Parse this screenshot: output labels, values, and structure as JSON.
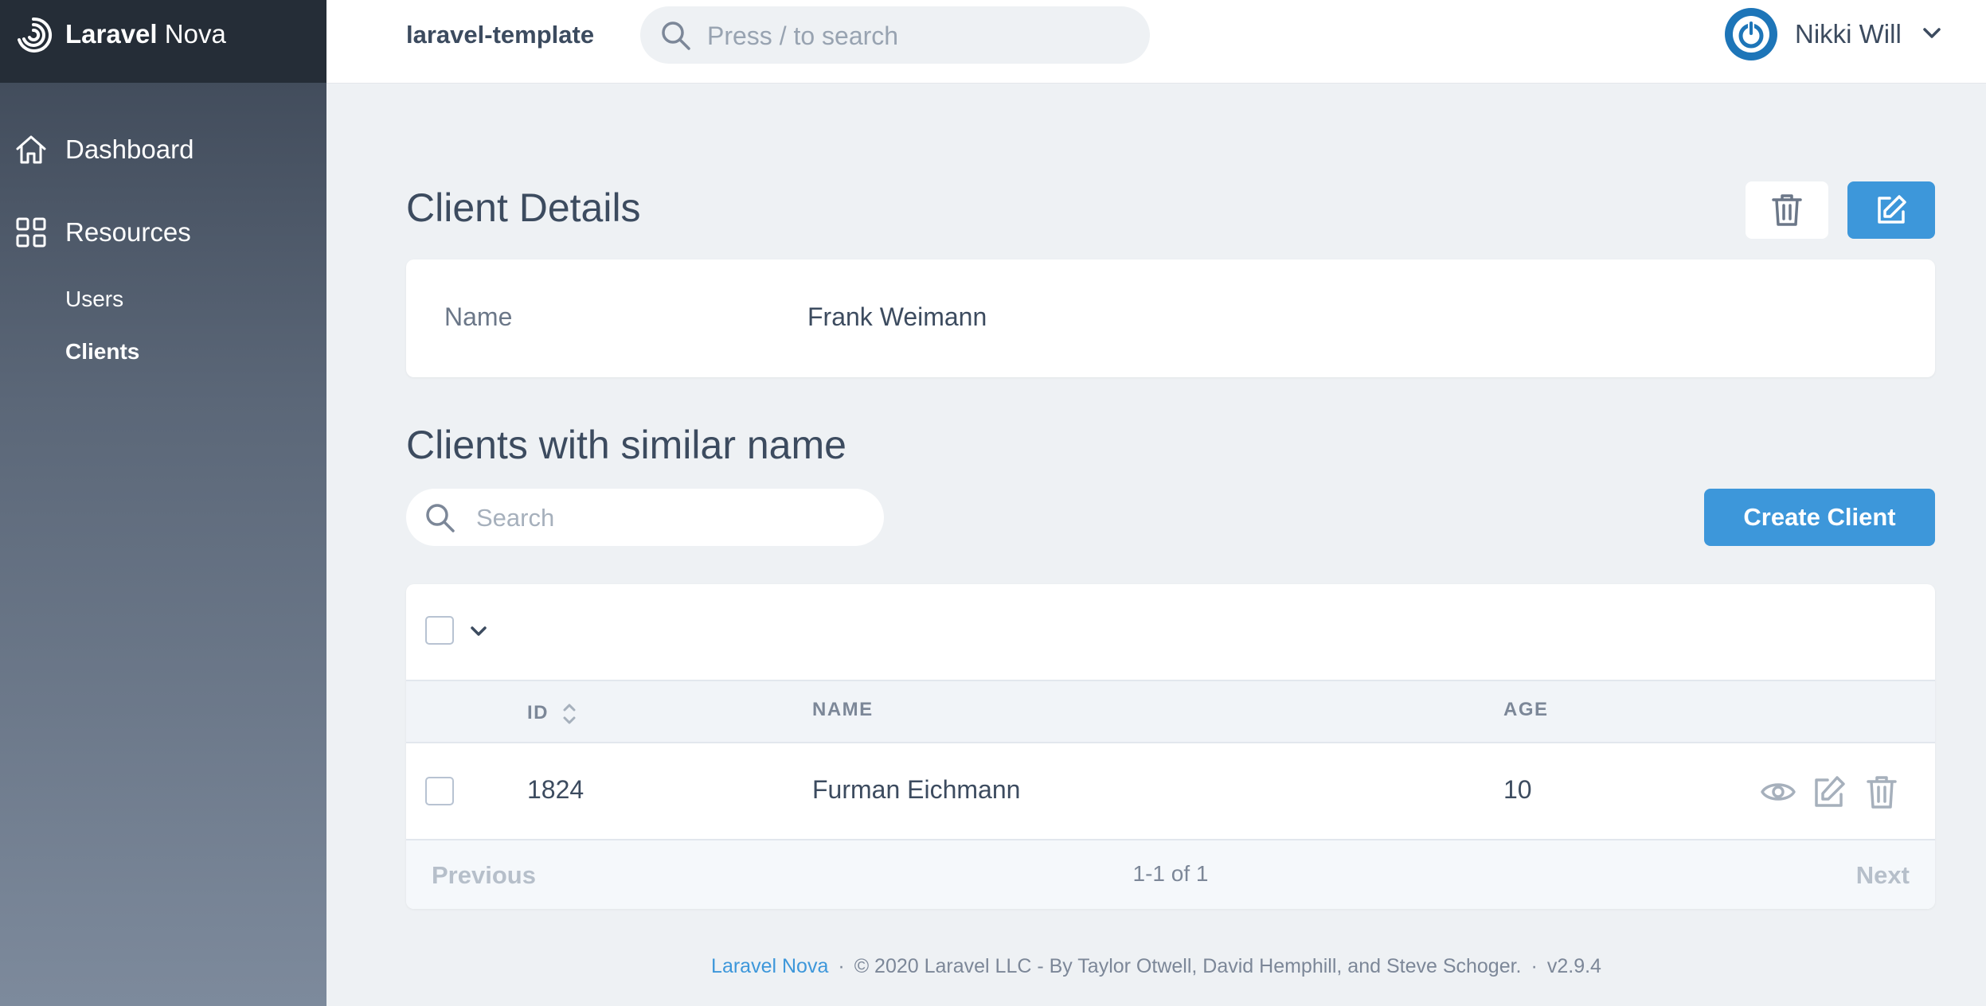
{
  "brand": {
    "bold": "Laravel",
    "rest": "Nova"
  },
  "sidebar": {
    "items": [
      {
        "label": "Dashboard",
        "icon": "home-icon"
      },
      {
        "label": "Resources",
        "icon": "grid-icon"
      }
    ],
    "resources": [
      {
        "label": "Users"
      },
      {
        "label": "Clients",
        "active": true
      }
    ]
  },
  "header": {
    "app_name": "laravel-template",
    "search_placeholder": "Press / to search",
    "user_name": "Nikki Will"
  },
  "details": {
    "title": "Client Details",
    "fields": [
      {
        "label": "Name",
        "value": "Frank Weimann"
      }
    ]
  },
  "related": {
    "title": "Clients with similar name",
    "search_placeholder": "Search",
    "create_label": "Create Client",
    "columns": {
      "id": "ID",
      "name": "NAME",
      "age": "AGE"
    },
    "rows": [
      {
        "id": "1824",
        "name": "Furman Eichmann",
        "age": "10"
      }
    ],
    "pagination": {
      "previous": "Previous",
      "info": "1-1 of 1",
      "next": "Next"
    }
  },
  "footer": {
    "link": "Laravel Nova",
    "separator": "·",
    "copyright": "© 2020 Laravel LLC - By Taylor Otwell, David Hemphill, and Steve Schoger.",
    "version": "v2.9.4"
  },
  "colors": {
    "primary": "#3d97da",
    "sidebar_top": "#252d37",
    "background": "#eef1f4"
  }
}
